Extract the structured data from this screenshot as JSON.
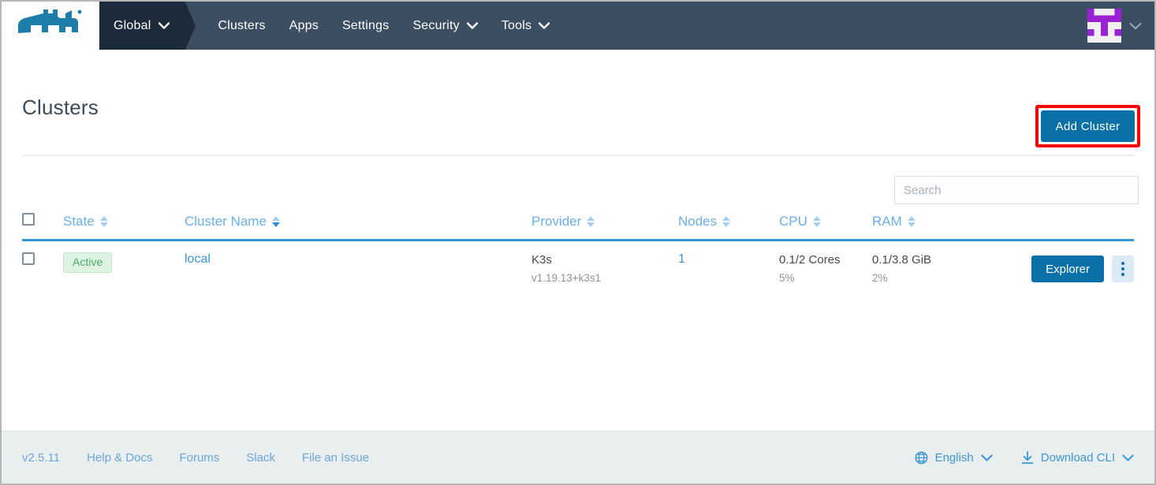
{
  "navbar": {
    "logo_alt": "rancher-cow-logo",
    "context": {
      "label": "Global",
      "icon": "chevron-down-icon"
    },
    "items": [
      {
        "label": "Clusters",
        "has_caret": false
      },
      {
        "label": "Apps",
        "has_caret": false
      },
      {
        "label": "Settings",
        "has_caret": false
      },
      {
        "label": "Security",
        "has_caret": true
      },
      {
        "label": "Tools",
        "has_caret": true
      }
    ],
    "avatar_icon": "user-identicon-avatar",
    "avatar_caret_icon": "chevron-down-icon",
    "colors": {
      "bar": "#3c4f62",
      "context_bg": "#1c2b3b",
      "avatar_accent": "#9b21d4"
    }
  },
  "page": {
    "title": "Clusters",
    "add_cluster_label": "Add Cluster",
    "annotation_color": "#ff0000",
    "primary_color": "#0a71a8"
  },
  "search": {
    "placeholder": "Search",
    "value": ""
  },
  "table": {
    "select_all_icon": "checkbox-unchecked-icon",
    "columns": [
      {
        "label": "State",
        "sort_icon": "sort-arrows-icon",
        "sorted": false
      },
      {
        "label": "Cluster Name",
        "sort_icon": "sort-arrows-icon",
        "sorted": true
      },
      {
        "label": "Provider",
        "sort_icon": "sort-arrows-icon",
        "sorted": false
      },
      {
        "label": "Nodes",
        "sort_icon": "sort-arrows-icon",
        "sorted": false
      },
      {
        "label": "CPU",
        "sort_icon": "sort-arrows-icon",
        "sorted": false
      },
      {
        "label": "RAM",
        "sort_icon": "sort-arrows-icon",
        "sorted": false
      }
    ],
    "rows": [
      {
        "checkbox_icon": "checkbox-unchecked-icon",
        "state": "Active",
        "state_color": "#4aaa63",
        "name": "local",
        "provider": "K3s",
        "provider_version": "v1.19.13+k3s1",
        "nodes": "1",
        "cpu": "0.1/2 Cores",
        "cpu_pct": "5%",
        "ram": "0.1/3.8 GiB",
        "ram_pct": "2%",
        "explorer_label": "Explorer",
        "menu_icon": "kebab-menu-icon"
      }
    ]
  },
  "footer": {
    "links": [
      {
        "label": "v2.5.11"
      },
      {
        "label": "Help & Docs"
      },
      {
        "label": "Forums"
      },
      {
        "label": "Slack"
      },
      {
        "label": "File an Issue"
      }
    ],
    "language": {
      "label": "English",
      "icon": "globe-icon",
      "caret": "chevron-down-icon"
    },
    "download": {
      "label": "Download CLI",
      "icon": "download-icon",
      "caret": "chevron-down-icon"
    }
  }
}
